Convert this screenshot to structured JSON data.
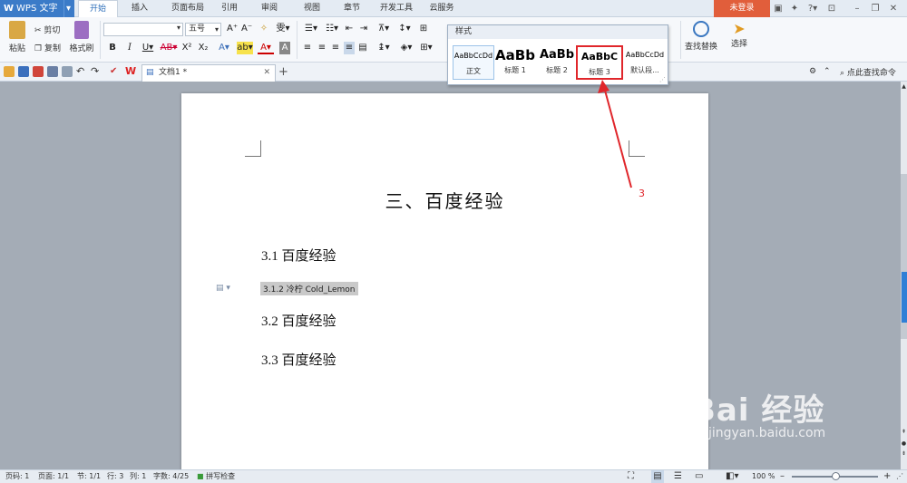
{
  "app": {
    "name": "WPS 文字"
  },
  "menu": {
    "tabs": [
      "开始",
      "插入",
      "页面布局",
      "引用",
      "审阅",
      "视图",
      "章节",
      "开发工具",
      "云服务"
    ],
    "active_tab": "开始",
    "login_label": "未登录"
  },
  "ribbon": {
    "paste_label": "粘贴",
    "cut_label": "剪切",
    "copy_label": "复制",
    "format_painter_label": "格式刷",
    "font_size": "五号",
    "find_replace_label": "查找替换",
    "select_label": "选择"
  },
  "styles_popup": {
    "title": "样式",
    "items": [
      {
        "sample": "AaBbCcDd",
        "label": "正文"
      },
      {
        "sample": "AaBb",
        "label": "标题 1"
      },
      {
        "sample": "AaBb",
        "label": "标题 2"
      },
      {
        "sample": "AaBbC",
        "label": "标题 3"
      },
      {
        "sample": "AaBbCcDd",
        "label": "默认段..."
      }
    ]
  },
  "quickbar": {
    "doc_tab_label": "文档1 *",
    "command_search": "点此查找命令"
  },
  "document": {
    "heading1": "三、百度经验",
    "heading2_1": "3.1 百度经验",
    "heading3_1": "3.1.2 冷柠 Cold_Lemon",
    "heading2_2": "3.2 百度经验",
    "heading2_3": "3.3 百度经验"
  },
  "annotation": {
    "number": "3",
    "color": "#e0262b"
  },
  "statusbar": {
    "page_code": "页码: 1",
    "pages": "页面: 1/1",
    "section": "节: 1/1",
    "row": "行: 3",
    "col": "列: 1",
    "words": "字数: 4/25",
    "spellcheck": "拼写检查",
    "zoom": "100 %"
  },
  "watermark": {
    "brand": "Bai 经验",
    "url": "jingyan.baidu.com"
  }
}
